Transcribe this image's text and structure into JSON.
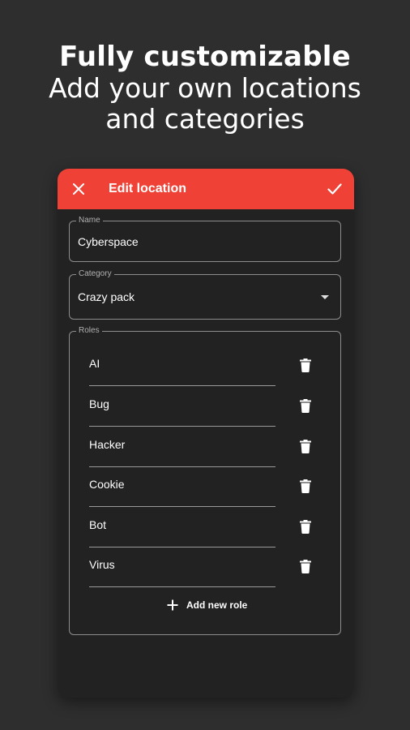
{
  "promo": {
    "title": "Fully customizable",
    "subtitle": "Add your own locations and categories"
  },
  "app_bar": {
    "title": "Edit location",
    "close_icon": "close-icon",
    "save_icon": "check-icon",
    "color": "#ef4136"
  },
  "form": {
    "name": {
      "label": "Name",
      "value": "Cyberspace"
    },
    "category": {
      "label": "Category",
      "value": "Crazy pack",
      "icon": "dropdown-arrow-icon"
    },
    "roles": {
      "label": "Roles",
      "items": [
        {
          "name": "AI"
        },
        {
          "name": "Bug"
        },
        {
          "name": "Hacker"
        },
        {
          "name": "Cookie"
        },
        {
          "name": "Bot"
        },
        {
          "name": "Virus"
        }
      ],
      "delete_icon": "trash-icon",
      "add_label": "Add new role",
      "add_icon": "plus-icon"
    }
  }
}
